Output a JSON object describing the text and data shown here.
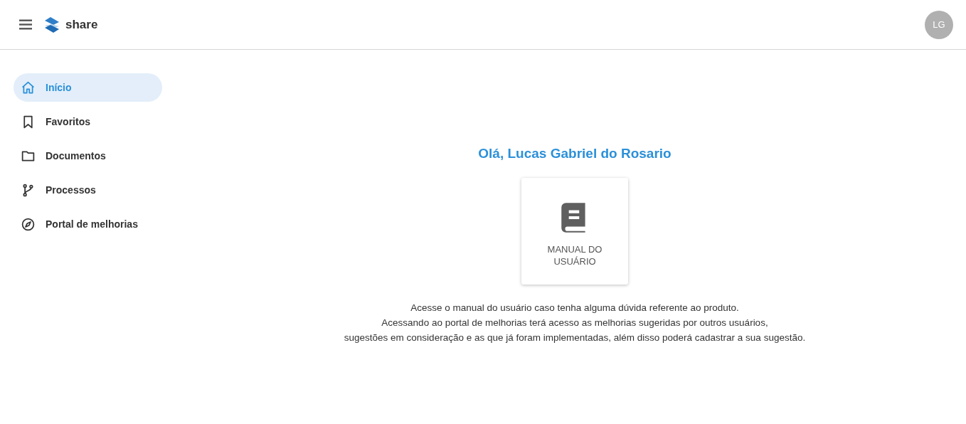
{
  "header": {
    "logo_text": "share",
    "avatar": "LG"
  },
  "sidebar": {
    "items": [
      {
        "label": "Início",
        "kind": "home",
        "selected": true
      },
      {
        "label": "Favoritos",
        "kind": "bookmark",
        "selected": false
      },
      {
        "label": "Documentos",
        "kind": "folder",
        "selected": false
      },
      {
        "label": "Processos",
        "kind": "branch",
        "selected": false
      },
      {
        "label": "Portal de melhorias",
        "kind": "compass",
        "selected": false
      }
    ]
  },
  "main": {
    "greeting": "Olá, Lucas Gabriel do Rosario",
    "card": {
      "label": "MANUAL DO USUÁRIO"
    },
    "description_lines": [
      "Acesse o manual do usuário caso tenha alguma dúvida referente ao produto.",
      "Acessando ao portal de melhorias terá acesso as melhorias sugeridas por outros usuários,",
      "sugestões em consideração e as que já foram implementadas, além disso poderá cadastrar a sua sugestão."
    ]
  }
}
